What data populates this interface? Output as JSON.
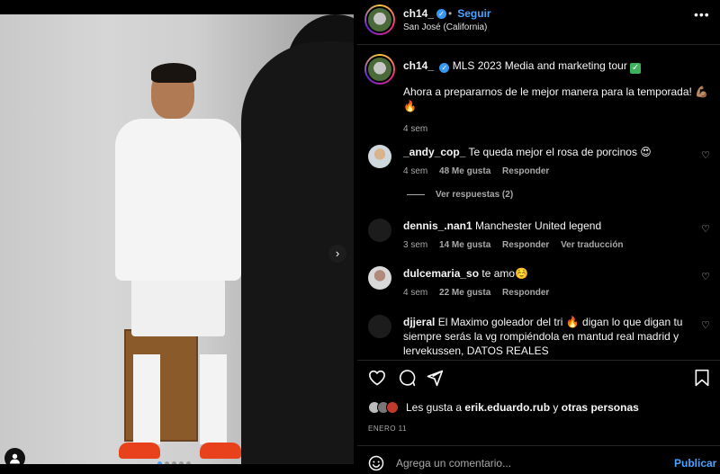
{
  "post": {
    "username": "ch14_",
    "follow_label": "Seguir",
    "location": "San José (California)",
    "more_icon": "•••"
  },
  "caption": {
    "username": "ch14_",
    "title": "MLS 2023 Media and marketing tour",
    "body": "Ahora a prepararnos de le mejor manera para la temporada! 💪🏽",
    "body_line2": "🔥",
    "time": "4 sem"
  },
  "comments": [
    {
      "username": "_andy_cop_",
      "text": "Te queda mejor el rosa de porcinos 😍",
      "time": "4 sem",
      "likes": "48 Me gusta",
      "reply": "Responder"
    },
    {
      "username": "dennis_.nan1",
      "text": "Manchester United legend",
      "time": "3 sem",
      "likes": "14 Me gusta",
      "reply": "Responder",
      "translate": "Ver traducción"
    },
    {
      "username": "dulcemaria_so",
      "text": "te amo☺️",
      "time": "4 sem",
      "likes": "22 Me gusta",
      "reply": "Responder"
    },
    {
      "username": "djjeral",
      "text": "El Maximo goleador del tri 🔥 digan lo que digan tu siempre serás la vg rompiéndola en mantud real madrid y lervekussen, DATOS REALES"
    }
  ],
  "view_replies": "Ver respuestas (2)",
  "likes": {
    "prefix": "Les gusta a",
    "user": "erik.eduardo.rub",
    "connector": "y",
    "others": "otras personas"
  },
  "date": "ENERO 11",
  "comment_box": {
    "placeholder": "Agrega un comentario...",
    "post_label": "Publicar"
  },
  "carousel": {
    "count": 5,
    "active": 0
  },
  "colors": {
    "accent": "#4aa3ff",
    "background": "#000000",
    "verified": "#3897f0"
  }
}
